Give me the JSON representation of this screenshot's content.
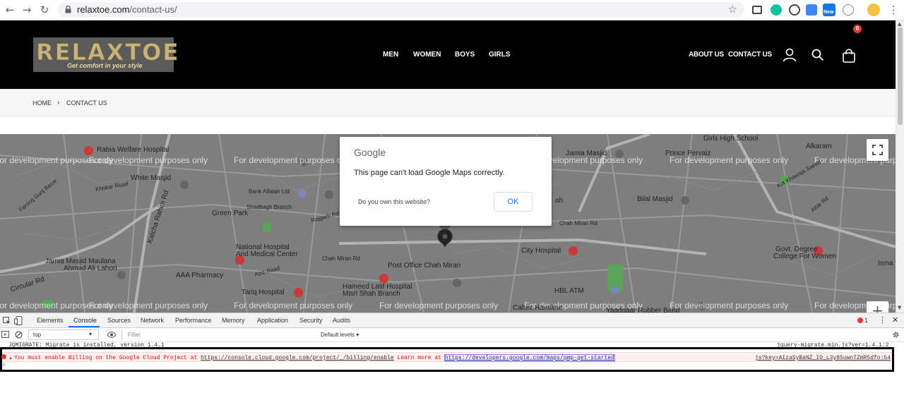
{
  "browser": {
    "back_icon": "arrow-left-icon",
    "forward_icon": "arrow-right-icon",
    "reload_icon": "reload-icon",
    "url_host": "relaxtoe.com",
    "url_path": "/contact-us/",
    "bookmark_icon": "star-icon",
    "ext_badge": "New"
  },
  "header": {
    "logo_text": "RELAXTOE",
    "logo_tagline": "Get comfort in your style",
    "nav": [
      "MEN",
      "WOMEN",
      "BOYS",
      "GIRLS"
    ],
    "right_nav": [
      "ABOUT US",
      "CONTACT US"
    ],
    "cart_count": "0"
  },
  "breadcrumb": {
    "home": "HOME",
    "separator": "›",
    "current": "CONTACT US"
  },
  "map": {
    "watermark": "For development purposes only",
    "places": {
      "rabia": "Rabia Welfare Hospital",
      "white_masjid": "White Masjid",
      "green_park": "Green Park",
      "bank_alfalah": "Bank Alfalah Ltd",
      "shadbagh": "Shadbagh Branch",
      "national_hospital": "National Hospital",
      "medical_center": "And Medical Center",
      "jamia_ahmad": "Jamia Masjid Maulana",
      "ahmad_lahori": "Ahmad Ali Lahori",
      "aaa_pharmacy": "AAA Pharmacy",
      "tariq_hospital": "Tariq Hospital",
      "hameed_latif": "Hameed Latif Hospital",
      "misri_shah": "Misri Shah Branch",
      "post_office": "Post Office Chah Miran",
      "city_hospital": "City Hospital",
      "hbl_atm": "HBL ATM",
      "caltex": "Caltex Havoline",
      "yaadgaar": "Yaadgaar Rubber Band",
      "jamia_masjid": "Jamia Masjid",
      "prince_pervaiz": "Prince Pervaiz",
      "girls_high": "Girls High School",
      "alkaram": "Alkaram",
      "bilal_masjid": "Bilal Masjid",
      "govt_college": "Govt. Degree",
      "college_women": "College For Women",
      "chah_miran_rd": "Chah Miran Rd",
      "circular_rd": "Circular Rd",
      "katcha_rahim": "Katcha Rahim Rd",
      "rajgarh_rd": "Rajgarh Rd",
      "farooq_gunj": "Farooq Gunj Bazar",
      "khokar_road": "Khokar Road",
      "aziz_road": "Aziz Road",
      "kot_khawaja": "Kot Khawaja Saeed",
      "attar_rd": "Attar Rd",
      "isma": "Isma",
      "ah": "ah"
    },
    "fullscreen_icon": "fullscreen-icon",
    "zoom_in": "+"
  },
  "dialog": {
    "logo": "Google",
    "message": "This page can't load Google Maps correctly.",
    "question": "Do you own this website?",
    "ok": "OK"
  },
  "devtools": {
    "tabs": [
      "Elements",
      "Console",
      "Sources",
      "Network",
      "Performance",
      "Memory",
      "Application",
      "Security",
      "Audits"
    ],
    "active_tab": "Console",
    "error_count": "1",
    "context": "top",
    "filter_placeholder": "Filter",
    "levels": "Default levels ▾",
    "log1_text": "JQMIGRATE: Migrate is installed, version 1.4.1",
    "log1_src": "jquery-migrate.min.js?ver=1.4.1:2",
    "error_prefix": "You must enable Billing on the Google Cloud Project at",
    "error_link1": "https://console.cloud.google.com/project/_/billing/enable",
    "error_mid": "Learn more at",
    "error_link2": "https://developers.google.com/maps/gmp-get-started",
    "error_src": "js?key=AIzaSyBaNZ_IO_L3y85uwnTZmR5dfo:54",
    "prompt": "›"
  }
}
